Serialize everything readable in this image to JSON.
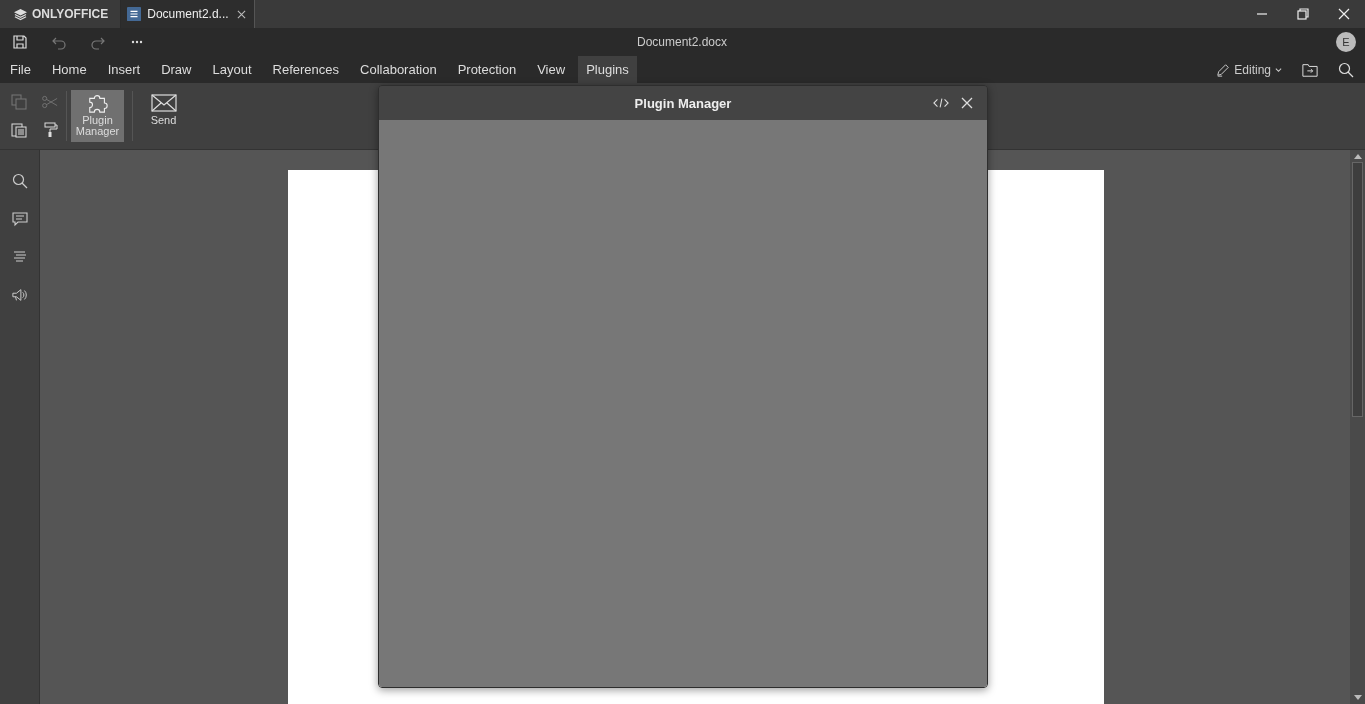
{
  "app": {
    "brand": "ONLYOFFICE"
  },
  "tabs": [
    {
      "label": "Document2.d...",
      "selected": true
    }
  ],
  "document_title": "Document2.docx",
  "user": {
    "initial": "E"
  },
  "menu": [
    {
      "label": "File",
      "selected": false
    },
    {
      "label": "Home",
      "selected": false
    },
    {
      "label": "Insert",
      "selected": false
    },
    {
      "label": "Draw",
      "selected": false
    },
    {
      "label": "Layout",
      "selected": false
    },
    {
      "label": "References",
      "selected": false
    },
    {
      "label": "Collaboration",
      "selected": false
    },
    {
      "label": "Protection",
      "selected": false
    },
    {
      "label": "View",
      "selected": false
    },
    {
      "label": "Plugins",
      "selected": true
    }
  ],
  "mode": "Editing",
  "ribbon": [
    {
      "label": "Plugin Manager",
      "selected": true
    },
    {
      "label": "Send",
      "selected": false
    }
  ],
  "dialog": {
    "title": "Plugin Manager"
  }
}
